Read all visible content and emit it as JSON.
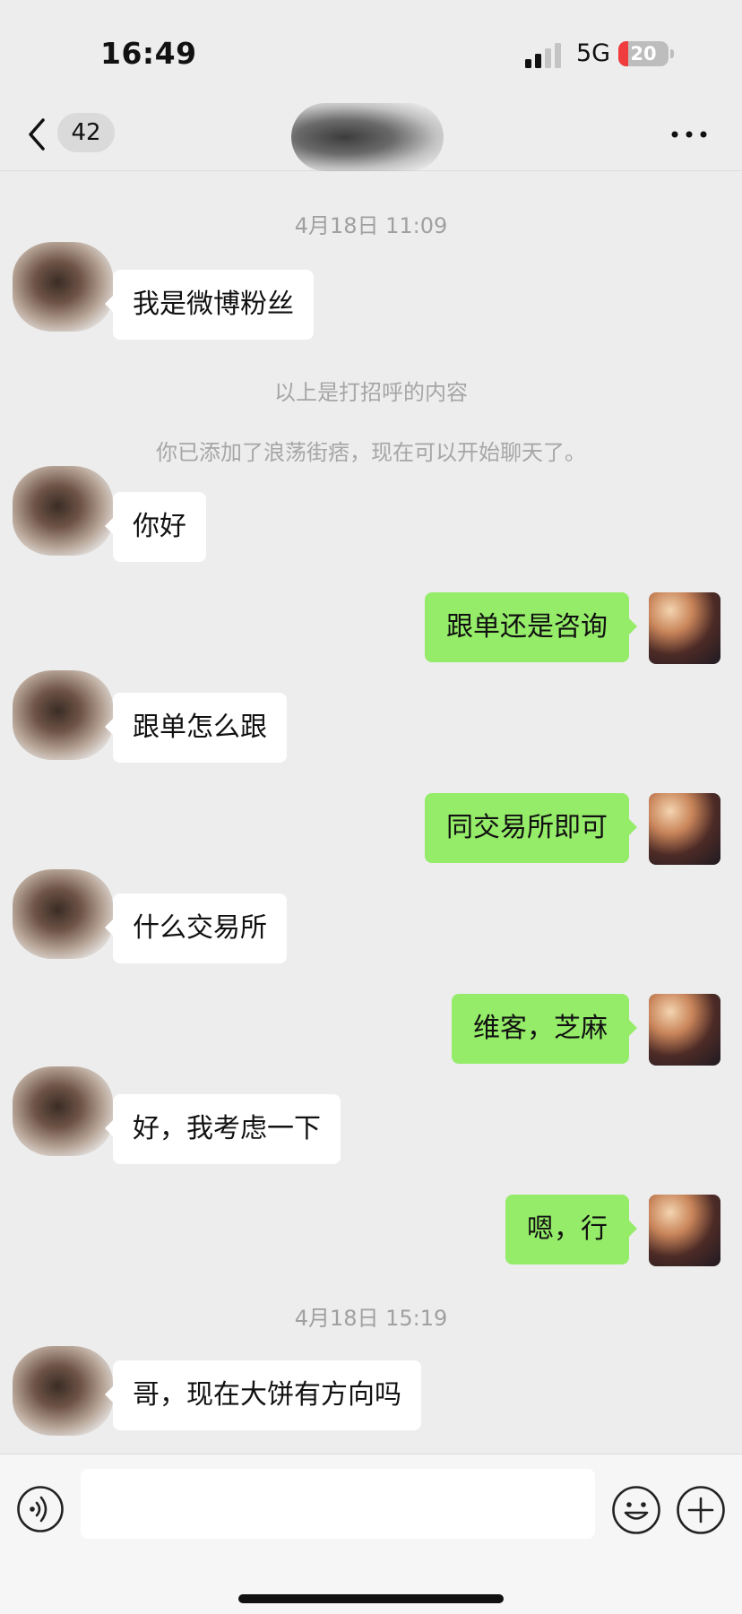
{
  "status_bar": {
    "time": "16:49",
    "network": "5G",
    "battery": "20",
    "battery_level": 0.2
  },
  "nav": {
    "unread_count": "42"
  },
  "messages": [
    {
      "type": "time",
      "text": "4月18日 11:09"
    },
    {
      "type": "in",
      "text": "我是微博粉丝"
    },
    {
      "type": "system",
      "text": "以上是打招呼的内容"
    },
    {
      "type": "system",
      "text": "你已添加了浪荡街痞，现在可以开始聊天了。"
    },
    {
      "type": "in",
      "text": "你好"
    },
    {
      "type": "out",
      "text": "跟单还是咨询"
    },
    {
      "type": "in",
      "text": "跟单怎么跟"
    },
    {
      "type": "out",
      "text": "同交易所即可"
    },
    {
      "type": "in",
      "text": "什么交易所"
    },
    {
      "type": "out",
      "text": "维客，芝麻"
    },
    {
      "type": "in",
      "text": "好，我考虑一下"
    },
    {
      "type": "out",
      "text": "嗯，行"
    },
    {
      "type": "time",
      "text": "4月18日 15:19"
    },
    {
      "type": "in",
      "text": "哥，现在大饼有方向吗"
    }
  ],
  "colors": {
    "outgoing_bubble": "#95ec69",
    "incoming_bubble": "#ffffff",
    "background": "#ededed"
  },
  "icons": {
    "back": "chevron-left-icon",
    "more": "more-dots-icon",
    "voice": "voice-icon",
    "emoji": "emoji-icon",
    "plus": "plus-icon"
  }
}
